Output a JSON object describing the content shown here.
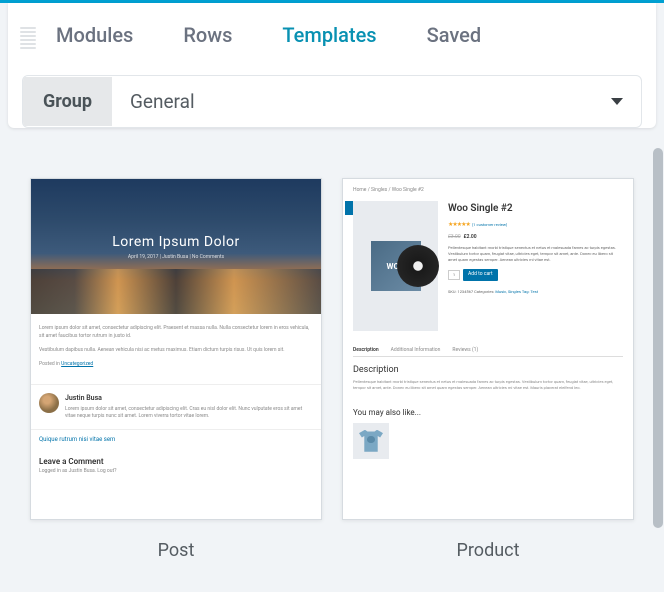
{
  "tabs": {
    "modules": "Modules",
    "rows": "Rows",
    "templates": "Templates",
    "saved": "Saved"
  },
  "active_tab": "templates",
  "group": {
    "label": "Group",
    "selected": "General"
  },
  "templates": [
    {
      "label": "Post",
      "preview": {
        "title": "Lorem Ipsum Dolor",
        "meta": "April 19, 2017 | Justin Busa | No Comments",
        "body1": "Lorem ipsum dolor sit amet, consectetur adipiscing elit. Praesent et massa nulla. Nulla consectetur lorem in eros vehicula, sit amet faucibus tortor rutrum in justo id.",
        "body2": "Vestibulum dapibus nulla. Aenean vehicula nisi ac metus maximus. Etiam dictum turpis risus. Ut quis lorem sit.",
        "posted_in": "Posted in",
        "cat_link": "Uncategorized",
        "author_name": "Justin Busa",
        "author_bio": "Lorem ipsum dolor sit amet, consectetur adipiscing elit. Cras eu nisl dolor elit. Nunc vulputate eros sit amet vitae neque turpis nunc sit amet. Lorem viverra tortor vitae lorem.",
        "footer_link": "Quique rutrum nisi vitae sem",
        "comment_heading": "Leave a Comment",
        "comment_sub": "Logged in as Justin Busa. Log out?"
      }
    },
    {
      "label": "Product",
      "preview": {
        "breadcrumb": "Home / Singles / Woo Single #2",
        "name": "Woo Single #2",
        "stars": "★★★★★",
        "reviews": "(1 customer review)",
        "old_price": "£3.00",
        "new_price": "£2.00",
        "desc": "Pellentesque habitant morbi tristique senectus et netus et malesuada fames ac turpis egestas. Vestibulum tortor quam, feugiat vitae, ultricies eget, tempor sit amet, ante. Donec eu libero sit amet quam egestas semper. Aenean ultricies mi vitae est.",
        "qty": "1",
        "add_label": "Add to cart",
        "sku_line": "SKU: 1234567 Categories: ",
        "cats": "Music, Singles Tag: Test",
        "sleeve": "WOO",
        "tabs": {
          "desc": "Description",
          "info": "Additional Information",
          "rev": "Reviews (1)"
        },
        "section_h": "Description",
        "section_p": "Pellentesque habitant morbi tristique senectus et netus et malesuada fames ac turpis egestas. Vestibulum tortor quam, feugiat vitae, ultricies eget, tempor sit amet, ante. Donec eu libero sit amet quam egestas semper. Aenean ultricies mi vitae est. Mauris placerat eleifend leo.",
        "like_h": "You may also like..."
      }
    }
  ]
}
